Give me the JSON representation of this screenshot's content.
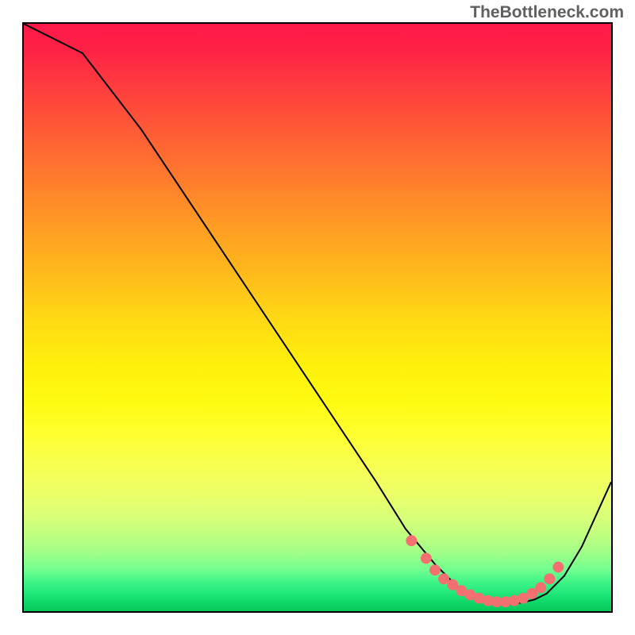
{
  "watermark": "TheBottleneck.com",
  "chart_data": {
    "type": "line",
    "title": "",
    "xlabel": "",
    "ylabel": "",
    "xlim": [
      0,
      100
    ],
    "ylim": [
      0,
      100
    ],
    "series": [
      {
        "name": "bottleneck-curve",
        "x": [
          0,
          4,
          10,
          20,
          30,
          40,
          50,
          60,
          65,
          70,
          73,
          75,
          77,
          79,
          81,
          83,
          85,
          87,
          89,
          92,
          95,
          100
        ],
        "y": [
          100,
          98,
          95,
          82,
          67,
          52,
          37,
          22,
          14,
          8,
          5,
          3,
          2,
          1.5,
          1.2,
          1.2,
          1.5,
          2,
          3,
          6,
          11,
          22
        ]
      }
    ],
    "highlight_points": {
      "name": "optimal-range-dots",
      "x": [
        66,
        68.5,
        70,
        71.5,
        73,
        74.5,
        76,
        77.5,
        79,
        80.5,
        82,
        83.5,
        85,
        86.5,
        88,
        89.5,
        91
      ],
      "y": [
        12,
        9,
        7,
        5.5,
        4.5,
        3.5,
        2.8,
        2.2,
        1.8,
        1.6,
        1.6,
        1.8,
        2.2,
        3,
        4,
        5.5,
        7.5
      ]
    },
    "background_gradient": {
      "top": "#ff1a4a",
      "middle": "#fff00c",
      "bottom": "#08c858"
    }
  }
}
